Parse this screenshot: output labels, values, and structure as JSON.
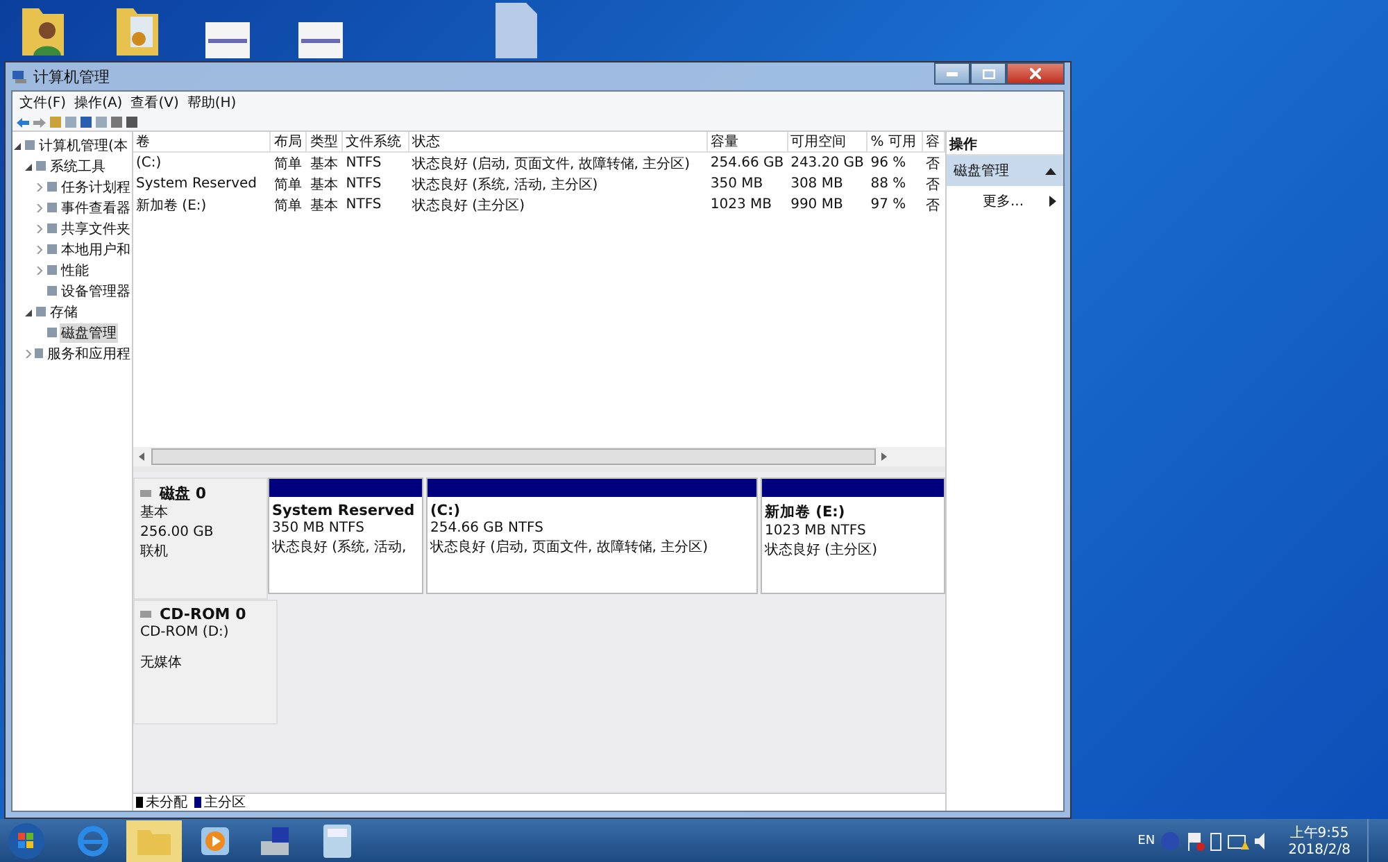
{
  "window": {
    "title": "计算机管理"
  },
  "menu": [
    "文件(F)",
    "操作(A)",
    "查看(V)",
    "帮助(H)"
  ],
  "tree": [
    {
      "label": "计算机管理(本",
      "selected": false,
      "expanded": true,
      "children": [
        {
          "label": "系统工具",
          "selected": false,
          "expanded": true,
          "children": [
            {
              "label": "任务计划程",
              "selected": false,
              "expanded": false
            },
            {
              "label": "事件查看器",
              "selected": false,
              "expanded": false
            },
            {
              "label": "共享文件夹",
              "selected": false,
              "expanded": false
            },
            {
              "label": "本地用户和",
              "selected": false,
              "expanded": false
            },
            {
              "label": "性能",
              "selected": false,
              "expanded": false
            },
            {
              "label": "设备管理器",
              "selected": false
            }
          ]
        },
        {
          "label": "存储",
          "selected": false,
          "expanded": true,
          "children": [
            {
              "label": "磁盘管理",
              "selected": true
            }
          ]
        },
        {
          "label": "服务和应用程",
          "selected": false,
          "expanded": false
        }
      ]
    }
  ],
  "table": {
    "columns": [
      "卷",
      "布局",
      "类型",
      "文件系统",
      "状态",
      "容量",
      "可用空间",
      "% 可用",
      "容"
    ],
    "rows": [
      [
        "(C:)",
        "简单",
        "基本",
        "NTFS",
        "状态良好 (启动, 页面文件, 故障转储, 主分区)",
        "254.66 GB",
        "243.20 GB",
        "96 %",
        "否"
      ],
      [
        "System Reserved",
        "简单",
        "基本",
        "NTFS",
        "状态良好 (系统, 活动, 主分区)",
        "350 MB",
        "308 MB",
        "88 %",
        "否"
      ],
      [
        "新加卷 (E:)",
        "简单",
        "基本",
        "NTFS",
        "状态良好 (主分区)",
        "1023 MB",
        "990 MB",
        "97 %",
        "否"
      ]
    ]
  },
  "disks": [
    {
      "kind": "disk",
      "name": "磁盘 0",
      "type": "基本",
      "size": "256.00 GB",
      "status": "联机",
      "partitions": [
        {
          "name": "System Reserved",
          "size": "350 MB NTFS",
          "status": "状态良好 (系统, 活动,"
        },
        {
          "name": "(C:)",
          "size": "254.66 GB NTFS",
          "status": "状态良好 (启动, 页面文件, 故障转储, 主分区)"
        },
        {
          "name": "新加卷  (E:)",
          "size": "1023 MB NTFS",
          "status": "状态良好 (主分区)"
        }
      ]
    },
    {
      "kind": "cdrom",
      "name": "CD-ROM 0",
      "type": "CD-ROM (D:)",
      "status": "无媒体"
    }
  ],
  "legend": [
    {
      "label": "未分配",
      "color": "#000000"
    },
    {
      "label": "主分区",
      "color": "#00007f"
    }
  ],
  "actions": {
    "title": "操作",
    "section": "磁盘管理",
    "items": [
      "更多..."
    ]
  },
  "taskbar": {
    "apps": [
      {
        "kind": "ie",
        "selected": false
      },
      {
        "kind": "explorer",
        "selected": true
      },
      {
        "kind": "media",
        "selected": false
      },
      {
        "kind": "mgmt",
        "selected": false
      },
      {
        "kind": "calc",
        "selected": false
      }
    ],
    "language": "EN",
    "time": "上午9:55",
    "date": "2018/2/8"
  }
}
